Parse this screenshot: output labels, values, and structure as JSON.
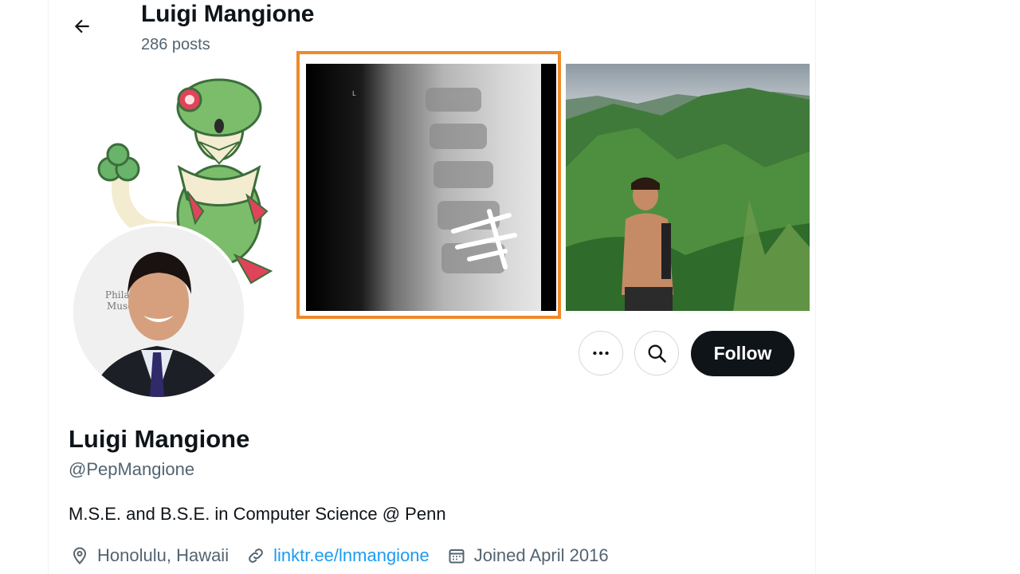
{
  "header": {
    "title": "Luigi Mangione",
    "posts_count": "286 posts"
  },
  "banner": {
    "highlight_color": "#f08a2a"
  },
  "actions": {
    "follow_label": "Follow"
  },
  "profile": {
    "display_name": "Luigi Mangione",
    "handle": "@PepMangione",
    "bio": "M.S.E. and B.S.E. in Computer Science @ Penn",
    "location": "Honolulu, Hawaii",
    "link": "linktr.ee/lnmangione",
    "joined": "Joined April 2016"
  },
  "colors": {
    "text_primary": "#0f1419",
    "text_secondary": "#536471",
    "link": "#1d9bf0",
    "follow_bg": "#0f1419"
  },
  "icons": {
    "back": "arrow-left-icon",
    "more": "more-dots-icon",
    "search": "search-icon",
    "location": "location-pin-icon",
    "link": "link-icon",
    "calendar": "calendar-icon"
  }
}
